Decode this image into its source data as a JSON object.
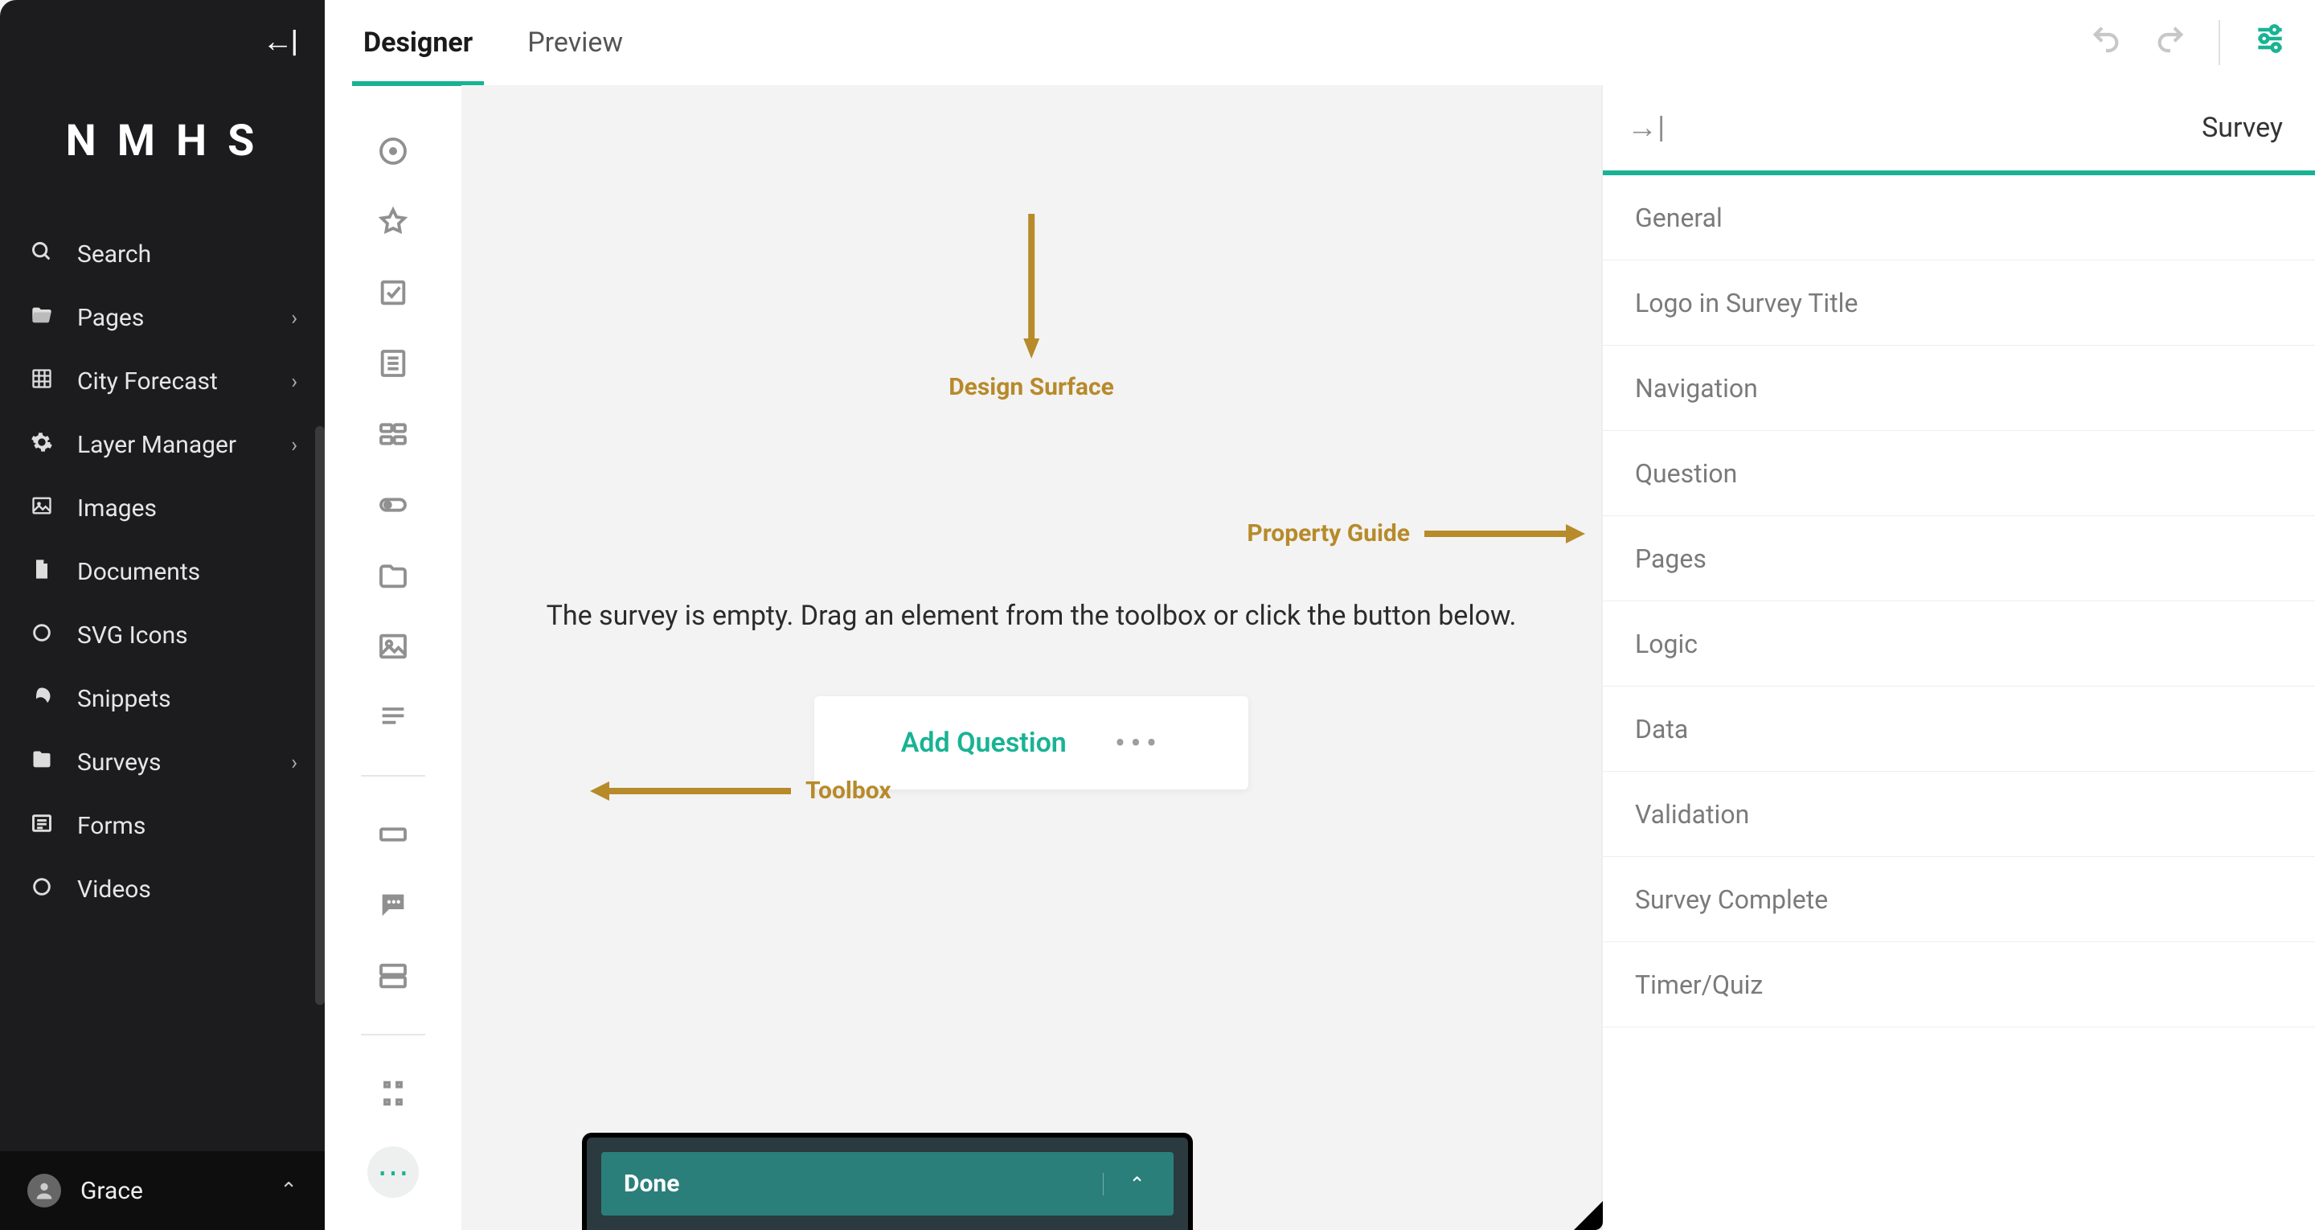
{
  "logo_text": "NMHS",
  "sidebar": {
    "items": [
      {
        "label": "Search",
        "icon": "search",
        "chevron": false
      },
      {
        "label": "Pages",
        "icon": "folder-open",
        "chevron": true
      },
      {
        "label": "City Forecast",
        "icon": "grid",
        "chevron": true
      },
      {
        "label": "Layer Manager",
        "icon": "gear",
        "chevron": true
      },
      {
        "label": "Images",
        "icon": "image",
        "chevron": false
      },
      {
        "label": "Documents",
        "icon": "file",
        "chevron": false
      },
      {
        "label": "SVG Icons",
        "icon": "circle",
        "chevron": false
      },
      {
        "label": "Snippets",
        "icon": "leaf",
        "chevron": false
      },
      {
        "label": "Surveys",
        "icon": "folder",
        "chevron": true
      },
      {
        "label": "Forms",
        "icon": "list",
        "chevron": false
      },
      {
        "label": "Videos",
        "icon": "circle",
        "chevron": false
      }
    ]
  },
  "user": {
    "name": "Grace"
  },
  "tabs": {
    "designer": "Designer",
    "preview": "Preview"
  },
  "toolbox_items": [
    "radiogroup",
    "rating",
    "checkbox",
    "dropdown",
    "tagbox",
    "boolean",
    "file",
    "image",
    "html",
    "input",
    "comment",
    "multipletext",
    "panel"
  ],
  "canvas": {
    "empty_text": "The survey is empty. Drag an element from the toolbox or click the button below.",
    "add_question": "Add Question"
  },
  "done_label": "Done",
  "annotations": {
    "design_surface": "Design Surface",
    "toolbox": "Toolbox",
    "property_guide": "Property Guide"
  },
  "property_panel": {
    "title": "Survey",
    "sections": [
      "General",
      "Logo in Survey Title",
      "Navigation",
      "Question",
      "Pages",
      "Logic",
      "Data",
      "Validation",
      "Survey Complete",
      "Timer/Quiz"
    ]
  }
}
